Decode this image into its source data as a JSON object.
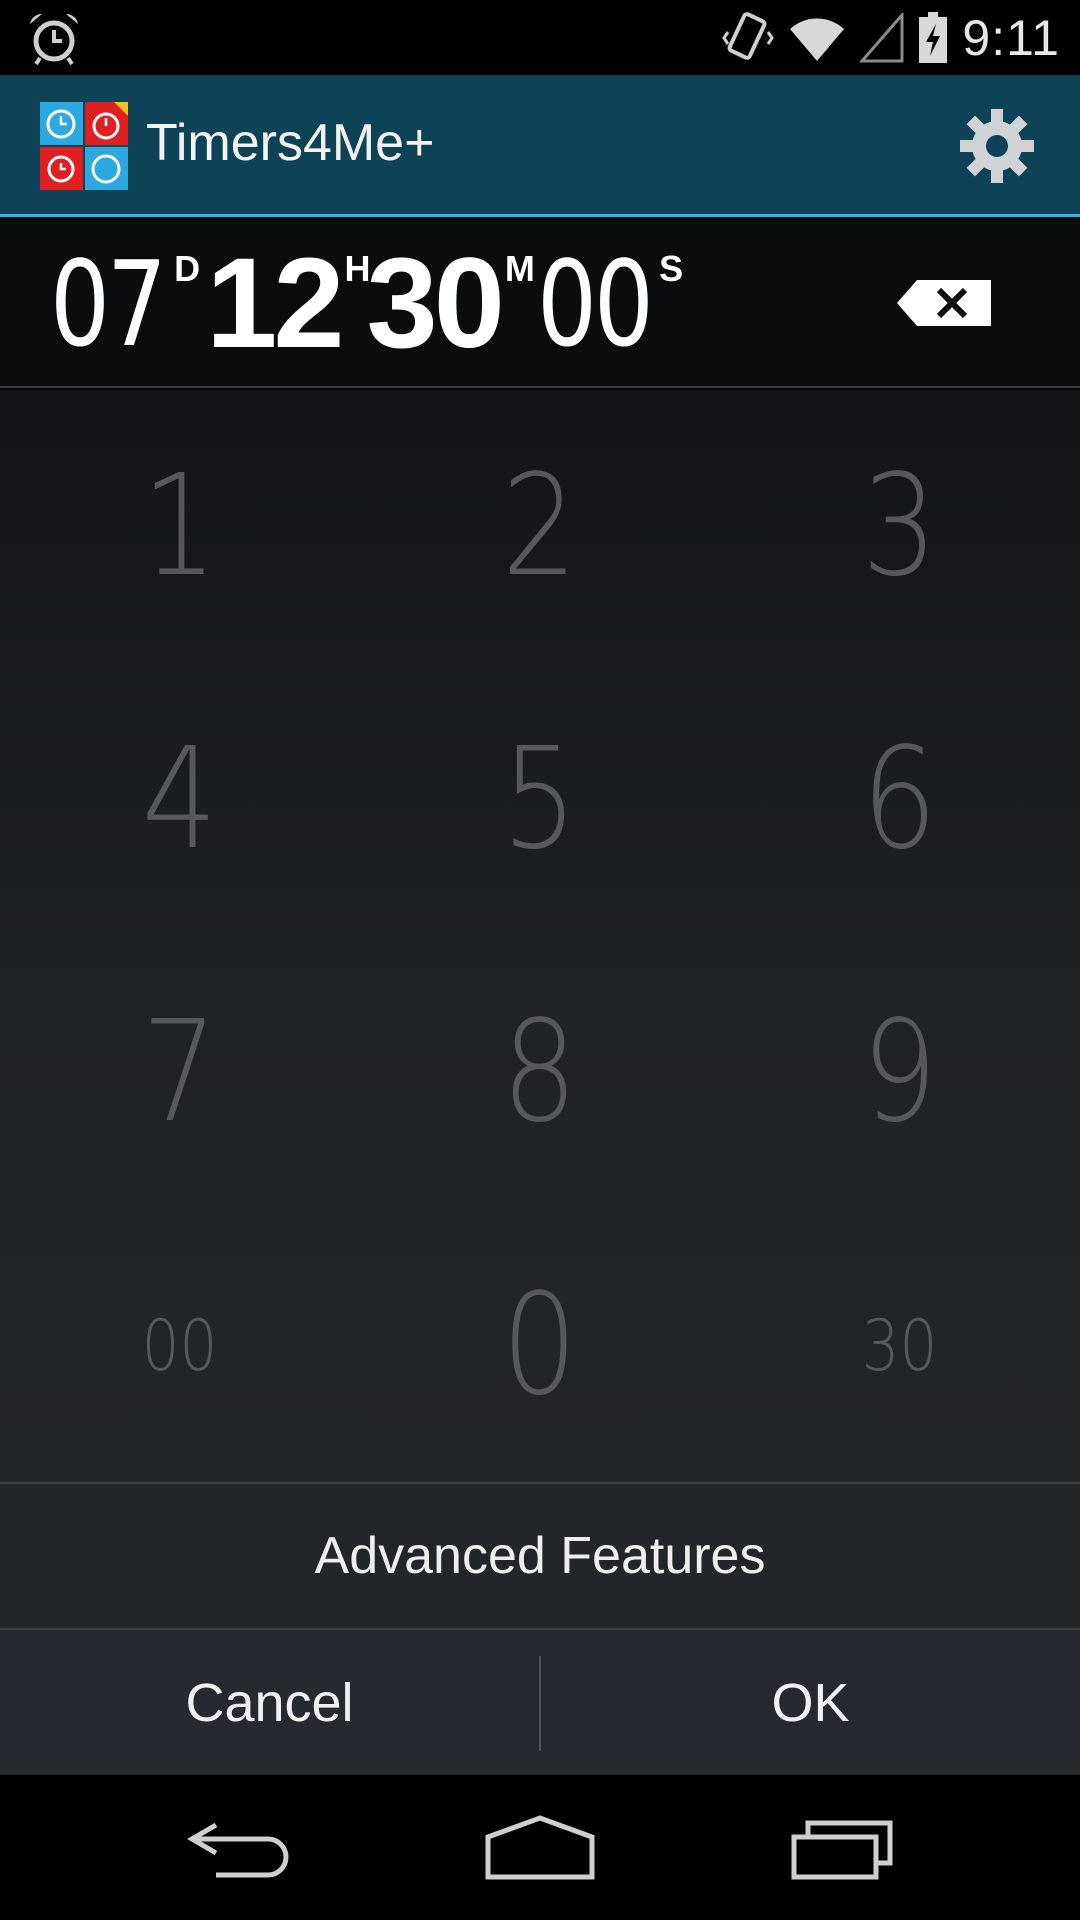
{
  "status_bar": {
    "time": "9:11",
    "icons": [
      "alarm-icon",
      "vibrate-icon",
      "wifi-icon",
      "signal-icon",
      "battery-charging-icon"
    ]
  },
  "action_bar": {
    "title": "Timers4Me+",
    "logo_icon": "timers4me-logo-icon",
    "settings_icon": "gear-icon",
    "accent_color": "#33b5e5",
    "background_color": "#0d4257"
  },
  "display": {
    "days": "07",
    "days_unit": "D",
    "hours": "12",
    "hours_unit": "H",
    "minutes": "30",
    "minutes_unit": "M",
    "seconds": "00",
    "seconds_unit": "S",
    "backspace_icon": "backspace-icon"
  },
  "keypad": {
    "keys": [
      "1",
      "2",
      "3",
      "4",
      "5",
      "6",
      "7",
      "8",
      "9",
      "00",
      "0",
      "30"
    ]
  },
  "advanced": {
    "label": "Advanced Features"
  },
  "buttons": {
    "cancel": "Cancel",
    "ok": "OK"
  },
  "nav_bar": {
    "icons": [
      "back-icon",
      "home-icon",
      "recents-icon"
    ]
  }
}
